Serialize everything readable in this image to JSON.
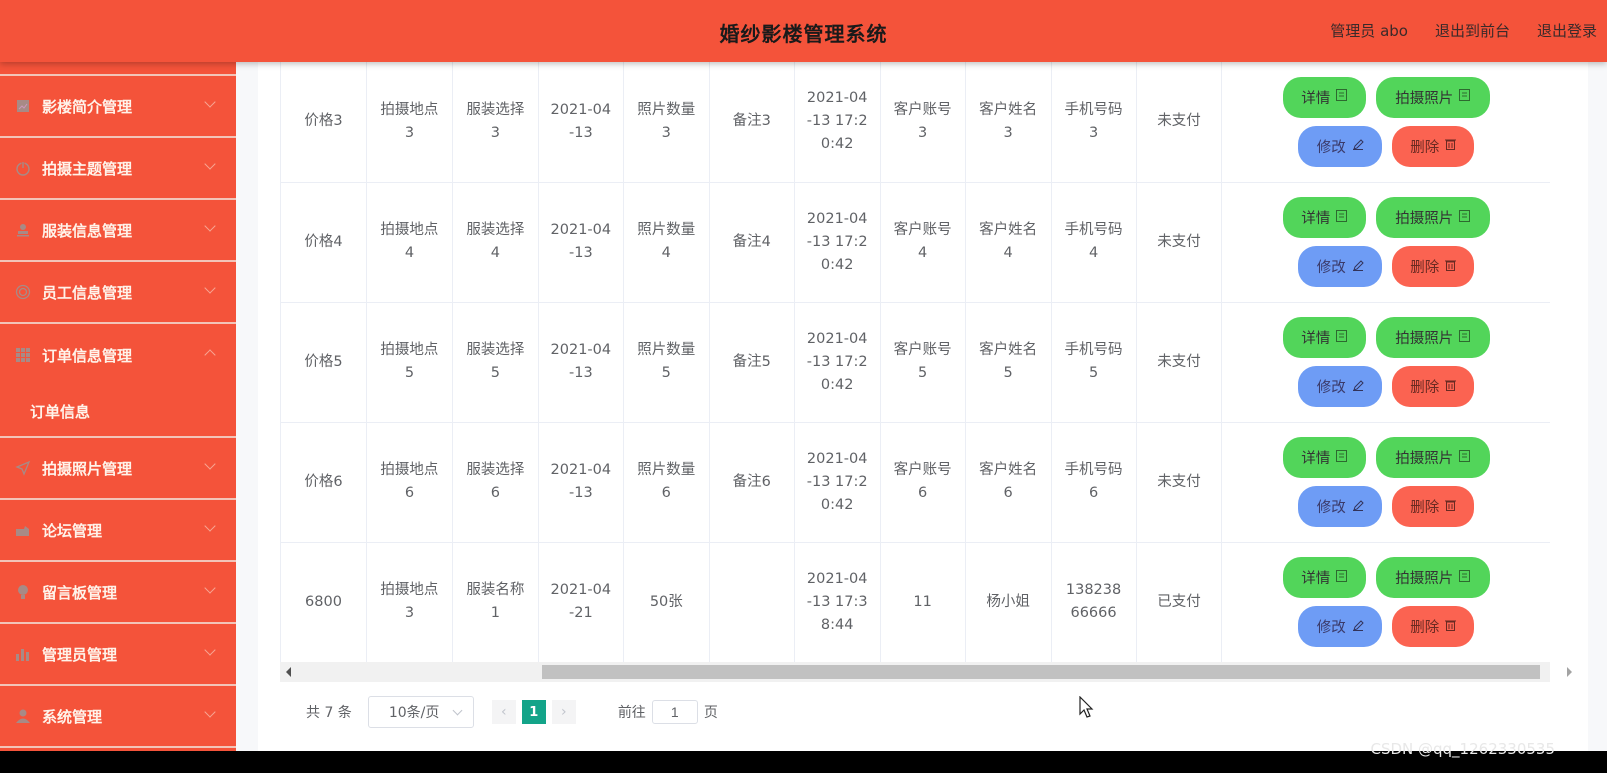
{
  "header": {
    "title": "婚纱影楼管理系统",
    "user": "管理员 abo",
    "to_front": "退出到前台",
    "logout": "退出登录"
  },
  "sidebar": {
    "items": [
      {
        "label": "影楼简介管理",
        "icon": "chart-icon"
      },
      {
        "label": "拍摄主题管理",
        "icon": "power-icon"
      },
      {
        "label": "服装信息管理",
        "icon": "stamp-icon"
      },
      {
        "label": "员工信息管理",
        "icon": "target-icon"
      },
      {
        "label": "订单信息管理",
        "icon": "grid-icon",
        "open": true,
        "children": [
          "订单信息"
        ]
      },
      {
        "label": "拍摄照片管理",
        "icon": "send-icon"
      },
      {
        "label": "论坛管理",
        "icon": "cart-icon"
      },
      {
        "label": "留言板管理",
        "icon": "bulb-icon"
      },
      {
        "label": "管理员管理",
        "icon": "bar-chart-icon"
      },
      {
        "label": "系统管理",
        "icon": "user-icon"
      }
    ]
  },
  "table": {
    "rows": [
      {
        "price": "价格3",
        "location": "拍摄地点3",
        "costume": "服装选择3",
        "date": "2021-04-13",
        "photos": "照片数量3",
        "note": "备注3",
        "created": "2021-04-13 17:20:42",
        "account": "客户账号3",
        "name": "客户姓名3",
        "phone": "手机号码3",
        "status": "未支付"
      },
      {
        "price": "价格4",
        "location": "拍摄地点4",
        "costume": "服装选择4",
        "date": "2021-04-13",
        "photos": "照片数量4",
        "note": "备注4",
        "created": "2021-04-13 17:20:42",
        "account": "客户账号4",
        "name": "客户姓名4",
        "phone": "手机号码4",
        "status": "未支付"
      },
      {
        "price": "价格5",
        "location": "拍摄地点5",
        "costume": "服装选择5",
        "date": "2021-04-13",
        "photos": "照片数量5",
        "note": "备注5",
        "created": "2021-04-13 17:20:42",
        "account": "客户账号5",
        "name": "客户姓名5",
        "phone": "手机号码5",
        "status": "未支付"
      },
      {
        "price": "价格6",
        "location": "拍摄地点6",
        "costume": "服装选择6",
        "date": "2021-04-13",
        "photos": "照片数量6",
        "note": "备注6",
        "created": "2021-04-13 17:20:42",
        "account": "客户账号6",
        "name": "客户姓名6",
        "phone": "手机号码6",
        "status": "未支付"
      },
      {
        "price": "6800",
        "location": "拍摄地点3",
        "costume": "服装名称1",
        "date": "2021-04-21",
        "photos": "50张",
        "note": "",
        "created": "2021-04-13 17:38:44",
        "account": "11",
        "name": "杨小姐",
        "phone": "13823866666",
        "status": "已支付"
      }
    ],
    "actions": {
      "detail": "详情",
      "photos": "拍摄照片",
      "edit": "修改",
      "delete": "删除"
    }
  },
  "pagination": {
    "total": "共 7 条",
    "page_size": "10条/页",
    "current_page": "1",
    "goto_label": "前往",
    "goto_value": "1",
    "page_suffix": "页"
  },
  "watermark": "CSDN @qq_1262330535",
  "colors": {
    "brand": "#f4533a",
    "green": "#52d55a",
    "blue": "#6e9cf5",
    "red": "#fb6351",
    "page_active": "#13a489"
  }
}
